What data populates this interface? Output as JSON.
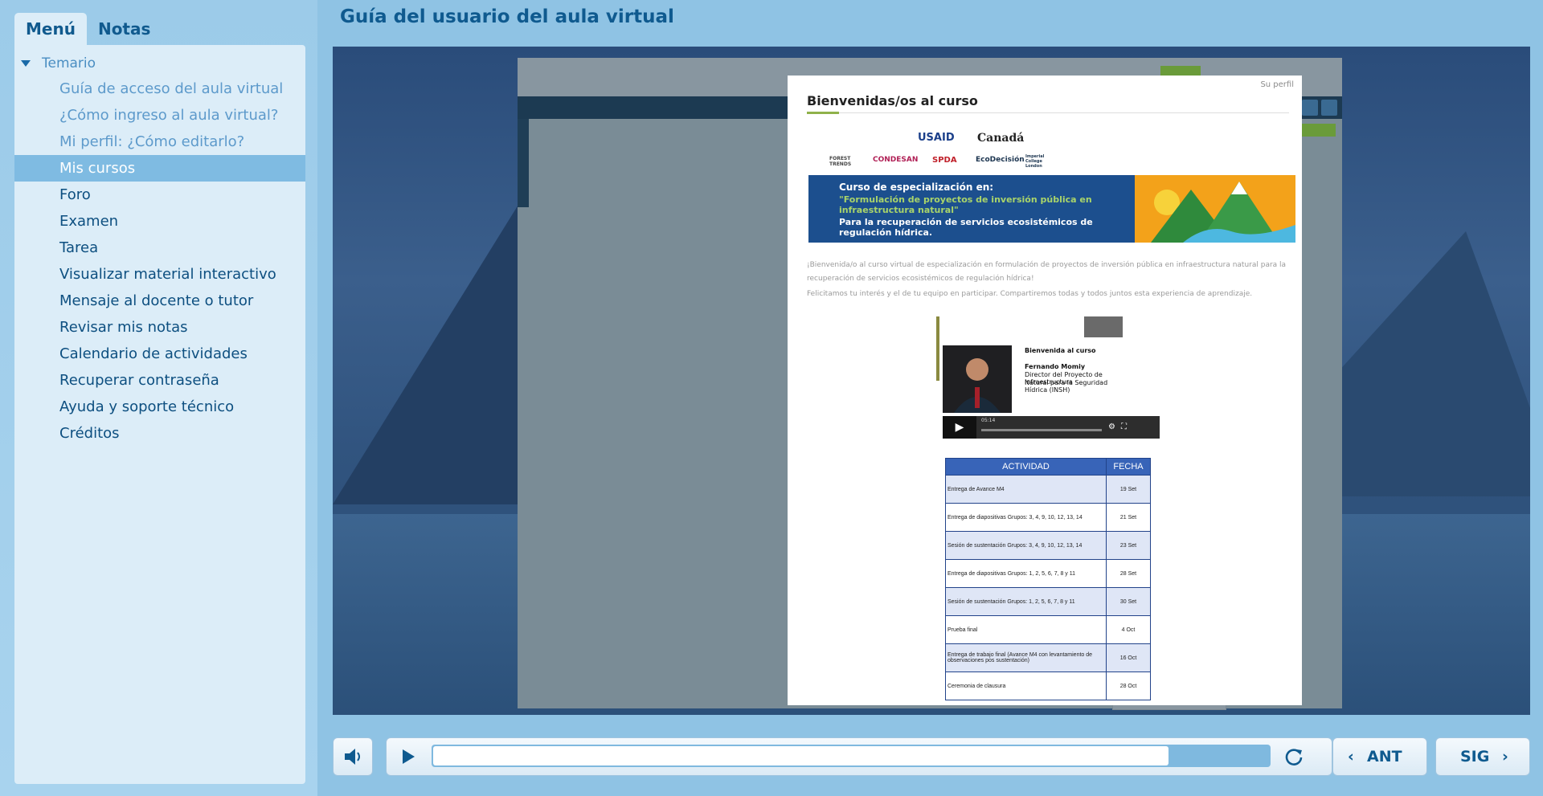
{
  "tabs": {
    "menu": "Menú",
    "notes": "Notas"
  },
  "tree": {
    "root": "Temario",
    "items": [
      {
        "label": "Guía de acceso del aula virtual",
        "state": "visited"
      },
      {
        "label": "¿Cómo ingreso al aula virtual?",
        "state": "visited"
      },
      {
        "label": "Mi perfil: ¿Cómo editarlo?",
        "state": "visited"
      },
      {
        "label": "Mis cursos",
        "state": "active"
      },
      {
        "label": "Foro",
        "state": "normal"
      },
      {
        "label": "Examen",
        "state": "normal"
      },
      {
        "label": "Tarea",
        "state": "normal"
      },
      {
        "label": "Visualizar material interactivo",
        "state": "normal"
      },
      {
        "label": "Mensaje al docente o tutor",
        "state": "normal"
      },
      {
        "label": "Revisar mis notas",
        "state": "normal"
      },
      {
        "label": "Calendario de actividades",
        "state": "normal"
      },
      {
        "label": "Recuperar contraseña",
        "state": "normal"
      },
      {
        "label": "Ayuda y soporte técnico",
        "state": "normal"
      },
      {
        "label": "Créditos",
        "state": "normal"
      }
    ]
  },
  "header": {
    "title": "Guía del usuario del aula virtual"
  },
  "doc": {
    "user": "Su perfil",
    "heading": "Bienvenidas/os al curso",
    "logos": [
      "USAID",
      "Canadá",
      "FOREST TRENDS",
      "CONDESAN",
      "SPDA",
      "EcoDecisión",
      "Imperial College London"
    ],
    "banner": {
      "line1": "Curso de especialización en:",
      "line2": "\"Formulación de proyectos de inversión pública en infraestructura natural\"",
      "line3": "Para la recuperación de servicios ecosistémicos de regulación hídrica."
    },
    "p1": "¡Bienvenida/o al curso virtual de especialización en formulación de proyectos de inversión pública en infraestructura natural para la recuperación de servicios ecosistémicos de regulación hídrica!",
    "p2": "Felicitamos tu interés y el de tu equipo en participar. Compartiremos todas y todos juntos esta experiencia de aprendizaje.",
    "video": {
      "title": "Bienvenida al curso",
      "name": "Fernando Momiy",
      "role1": "Director del Proyecto de Infraestructura",
      "role2": "Natural para la Seguridad Hídrica (INSH)",
      "time": "05:14"
    },
    "table": {
      "headers": [
        "ACTIVIDAD",
        "FECHA"
      ],
      "rows": [
        {
          "a": "Entrega de Avance M4",
          "f": "19 Set"
        },
        {
          "a": "Entrega de diapositivas Grupos: 3, 4, 9, 10, 12, 13, 14",
          "f": "21 Set"
        },
        {
          "a": "Sesión de sustentación Grupos: 3, 4, 9, 10, 12, 13, 14",
          "f": "23 Set"
        },
        {
          "a": "Entrega de diapositivas Grupos: 1, 2, 5, 6, 7, 8 y 11",
          "f": "28 Set"
        },
        {
          "a": "Sesión de sustentación Grupos: 1, 2, 5, 6, 7, 8 y 11",
          "f": "30 Set"
        },
        {
          "a": "Prueba final",
          "f": "4 Oct"
        },
        {
          "a": "Entrega de trabajo final (Avance M4 con levantamiento de observaciones pos sustentación)",
          "f": "16 Oct"
        },
        {
          "a": "Ceremonia de clausura",
          "f": "28 Oct"
        }
      ]
    }
  },
  "player": {
    "progress": 0.88
  },
  "nav": {
    "prev": "ANT",
    "next": "SIG"
  },
  "colors": {
    "accent": "#0f5a8f",
    "panel": "#dcedf8",
    "active_item": "#7fbbe2"
  }
}
